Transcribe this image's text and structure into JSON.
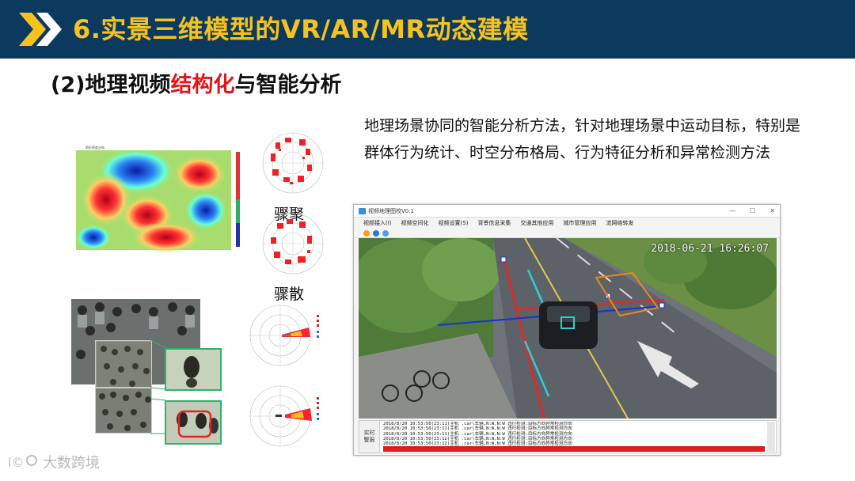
{
  "header": {
    "title": "6.实景三维模型的VR/AR/MR动态建模"
  },
  "subtitle": {
    "prefix": "(2)地理视频",
    "highlight": "结构化",
    "suffix": "与智能分析"
  },
  "description": "地理场景协同的智能分析方法，针对地理场景中运动目标，特别是群体行为统计、时空分布格局、行为特征分析和异常检测方法",
  "figures": {
    "label_gather": "骤聚",
    "label_scatter": "骤散"
  },
  "window": {
    "title": "视频地理图校V0.1",
    "menu": [
      "视频接入(I)",
      "视频空间化",
      "视频设置(S)",
      "背景信息采集",
      "交通其他应用",
      "城市管理应用",
      "流网络转发"
    ],
    "timestamp": "2018-06-21 16:26:07",
    "log_side_label_1": "实时",
    "log_side_label_2": "警报",
    "log_lines": [
      "2018/8/20 10:53:50(23:11)主机 .car\\车辆,N:W,N:W 违行检测:目标方向异常检测方向",
      "2018/8/20 10:53:50(23:11)主机 .car\\车辆,N:W,N:W 违行检测:目标方向异常检测方向",
      "2018/8/20 10:53:50(23:11)主机 .car\\车辆,N:W,N:W 违行检测:目标方向异常检测方向",
      "2018/8/20 10:53:50(23:12)主机 .car\\车辆,N:W,N:W 违行检测:目标方向异常检测方向",
      "2018/8/20 10:53:50(23:12)主机 .car\\车辆,N:W,N:W 违行检测:目标方向异常检测方向",
      "2018/8/20 10:53:50(23:12)主机 .car\\车辆,N:W,N:W 违行检测:目标方向异常检测方向"
    ]
  },
  "footer": {
    "brand": "大数跨境"
  },
  "colors": {
    "header_bg": "#0b3a5e",
    "title_accent": "#f8c21e",
    "highlight": "#e0161a"
  }
}
